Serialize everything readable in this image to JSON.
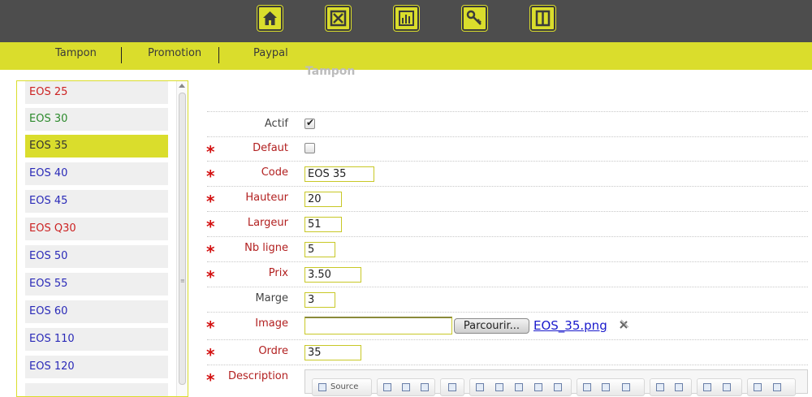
{
  "top_icons": [
    {
      "name": "home-icon"
    },
    {
      "name": "tools-icon"
    },
    {
      "name": "stats-icon"
    },
    {
      "name": "key-icon"
    },
    {
      "name": "book-icon"
    }
  ],
  "nav": {
    "tabs": [
      "Tampon",
      "Promotion",
      "Paypal"
    ]
  },
  "list": {
    "items": [
      {
        "label": "EOS 25",
        "color": "red"
      },
      {
        "label": "EOS 30",
        "color": "green"
      },
      {
        "label": "EOS 35",
        "color": "selected"
      },
      {
        "label": "EOS 40",
        "color": "blue"
      },
      {
        "label": "EOS 45",
        "color": "blue"
      },
      {
        "label": "EOS Q30",
        "color": "red"
      },
      {
        "label": "EOS 50",
        "color": "blue"
      },
      {
        "label": "EOS 55",
        "color": "blue"
      },
      {
        "label": "EOS 60",
        "color": "blue"
      },
      {
        "label": "EOS 110",
        "color": "blue"
      },
      {
        "label": "EOS 120",
        "color": "blue"
      }
    ]
  },
  "form": {
    "title": "Tampon",
    "actif_label": "Actif",
    "actif_checked": true,
    "defaut_label": "Defaut",
    "defaut_checked": false,
    "code_label": "Code",
    "code_value": "EOS 35",
    "hauteur_label": "Hauteur",
    "hauteur_value": "20",
    "largeur_label": "Largeur",
    "largeur_value": "51",
    "nbligne_label": "Nb ligne",
    "nbligne_value": "5",
    "prix_label": "Prix",
    "prix_value": "3.50",
    "marge_label": "Marge",
    "marge_value": "3",
    "image_label": "Image",
    "browse_label": "Parcourir...",
    "image_file": "EOS_35.png",
    "ordre_label": "Ordre",
    "ordre_value": "35",
    "description_label": "Description",
    "required_marker": "*",
    "editor_source_label": "Source"
  },
  "colors": {
    "accent": "#dadd2c",
    "topbar": "#4d4d4d",
    "required": "#d31010"
  }
}
